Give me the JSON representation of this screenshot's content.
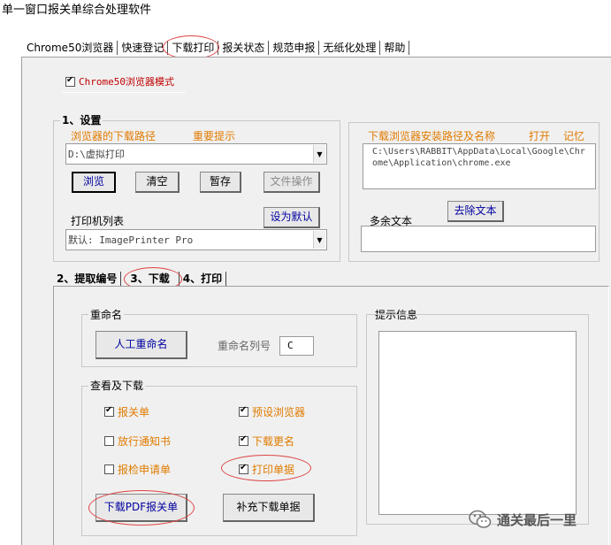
{
  "window": {
    "title": "单一窗口报关单综合处理软件"
  },
  "tabs": [
    "Chrome50浏览器",
    "快速登记",
    "下载打印",
    "报关状态",
    "规范申报",
    "无纸化处理",
    "帮助"
  ],
  "chrome_mode": {
    "label": "Chrome50浏览器模式",
    "checked": true
  },
  "settings": {
    "title": "1、设置",
    "download_path_label": "浏览器的下载路径",
    "important_label": "重要提示",
    "download_path_value": "D:\\虚拟打印",
    "buttons": {
      "browse": "浏览",
      "clear": "清空",
      "pause": "暂存",
      "file_ops": "文件操作"
    },
    "printer_list_label": "打印机列表",
    "set_default": "设为默认",
    "printer_value": "默认: ImagePrinter Pro"
  },
  "browser_install": {
    "label": "下载浏览器安装路径及名称",
    "open": "打开",
    "remember": "记忆",
    "path": "C:\\Users\\RABBIT\\AppData\\Local\\Google\\Chrome\\Application\\chrome.exe",
    "extra_text_label": "多余文本",
    "remove_text": "去除文本"
  },
  "subtabs": [
    "2、提取编号",
    "3、下载",
    "4、打印"
  ],
  "rename": {
    "title": "重命名",
    "manual_button": "人工重命名",
    "column_label": "重命名列号",
    "column_value": "C"
  },
  "view_download": {
    "title": "查看及下载",
    "items": [
      {
        "label": "报关单",
        "checked": true
      },
      {
        "label": "预设浏览器",
        "checked": true
      },
      {
        "label": "放行通知书",
        "checked": false
      },
      {
        "label": "下载更名",
        "checked": true
      },
      {
        "label": "报检申请单",
        "checked": false
      },
      {
        "label": "打印单据",
        "checked": true
      }
    ],
    "download_pdf": "下载PDF报关单",
    "supplement": "补充下载单据"
  },
  "info": {
    "title": "提示信息"
  },
  "watermark": "通关最后一里",
  "colors": {
    "accent_red": "#c00000",
    "label_orange": "#e07b00",
    "button_navy": "#0000a0",
    "circle": "#dd4444"
  }
}
